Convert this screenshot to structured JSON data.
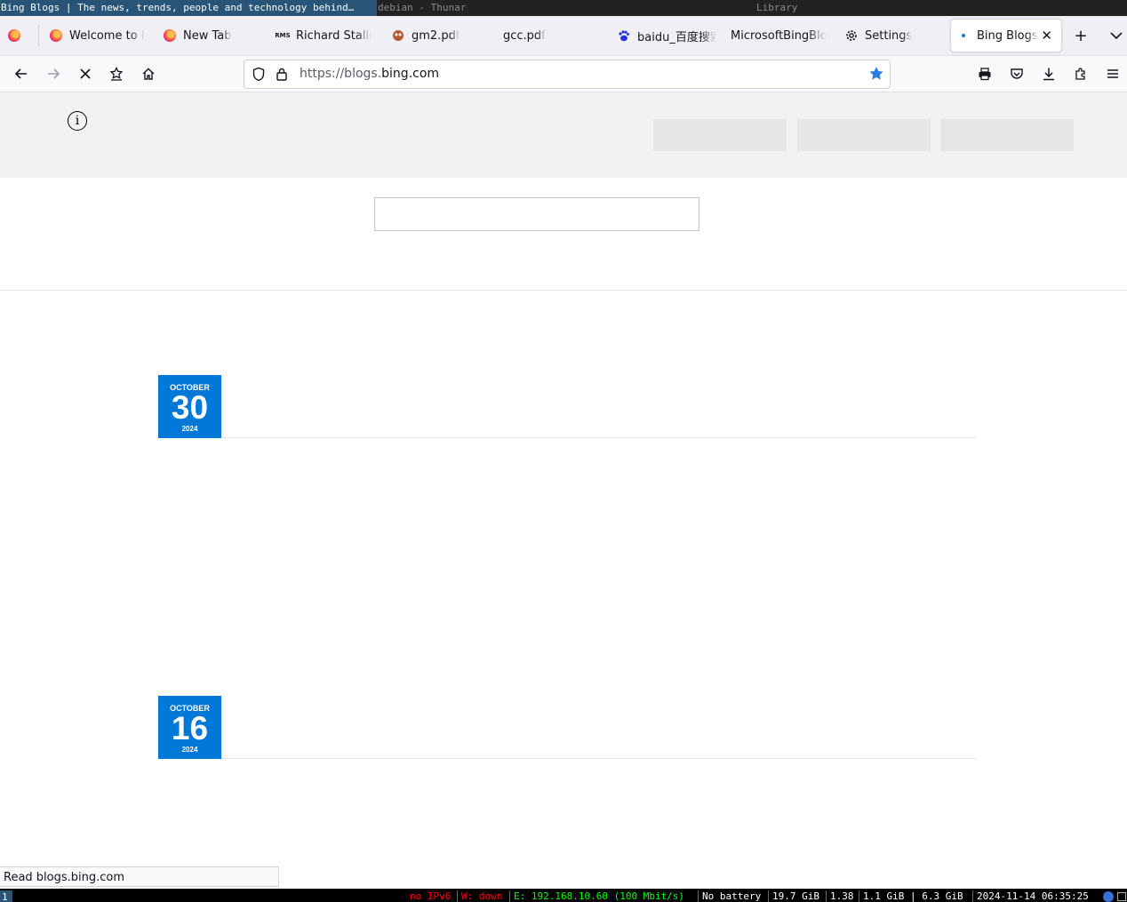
{
  "wm": {
    "active_title": "Bing Blogs | The news, trends, people and technology behind…",
    "thunar_title": "debian - Thunar",
    "library_title": "Library"
  },
  "tabs": [
    {
      "label": "",
      "icon": "firefox-icon"
    },
    {
      "label": "Welcome to F",
      "icon": "firefox-icon"
    },
    {
      "label": "New Tab",
      "icon": "firefox-icon"
    },
    {
      "label": "Richard Stallm",
      "icon": "rms-icon"
    },
    {
      "label": "gm2.pdf",
      "icon": "gnu-icon"
    },
    {
      "label": "gcc.pdf",
      "icon": "none"
    },
    {
      "label": "baidu_百度搜索",
      "icon": "baidu-paw-icon"
    },
    {
      "label": "MicrosoftBingBlo",
      "icon": "none"
    },
    {
      "label": "Settings",
      "icon": "gear-icon"
    },
    {
      "label": "Bing Blogs",
      "icon": "loading-dot-icon",
      "active": true
    }
  ],
  "rms_badge": "RMS",
  "nav": {
    "url_prefix": "https://blogs.",
    "url_domain": "bing.com"
  },
  "page": {
    "posts": [
      {
        "month": "OCTOBER",
        "day": "30",
        "year": "2024"
      },
      {
        "month": "OCTOBER",
        "day": "16",
        "year": "2024"
      }
    ]
  },
  "status_text": "Read blogs.bing.com",
  "i3bar": {
    "workspace": "1",
    "ipv6": "no IPv6",
    "wifi": "W: down",
    "ethernet": "E: 192.168.10.60 (100 Mbit/s)",
    "battery": "No battery",
    "disk": "19.7 GiB",
    "load": "1.38",
    "memory": "1.1 GiB | 6.3 GiB",
    "datetime": "2024-11-14 06:35:25"
  },
  "colors": {
    "accent": "#0078d7",
    "wm_active": "#285577",
    "status_red": "#ff0000",
    "status_green": "#00ff00"
  }
}
